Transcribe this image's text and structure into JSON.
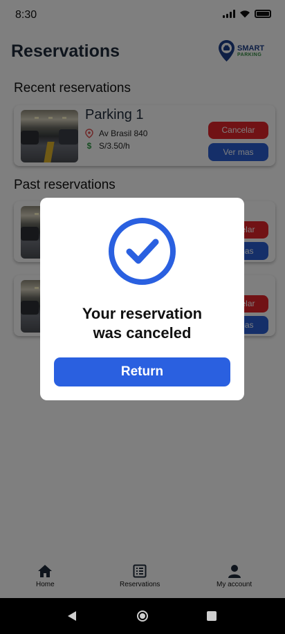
{
  "status_bar": {
    "time": "8:30"
  },
  "header": {
    "title": "Reservations",
    "logo_line1": "SMART",
    "logo_line2": "PARKING"
  },
  "recent": {
    "title": "Recent reservations",
    "card": {
      "name": "Parking 1",
      "address": "Av Brasil 840",
      "price": "S/3.50/h",
      "cancel_label": "Cancelar",
      "more_label": "Ver mas"
    }
  },
  "past": {
    "title": "Past reservations",
    "cards": [
      {
        "cancel_label": "Cancelar",
        "more_label": "Ver mas"
      },
      {
        "cancel_label": "Cancelar",
        "more_label": "Ver mas"
      }
    ]
  },
  "bottom_nav": {
    "items": [
      {
        "label": "Home",
        "icon": "home-icon"
      },
      {
        "label": "Reservations",
        "icon": "list-icon"
      },
      {
        "label": "My account",
        "icon": "person-icon"
      }
    ]
  },
  "modal": {
    "message_line1": "Your reservation",
    "message_line2": "was canceled",
    "button_label": "Return",
    "icon": "check-circle-icon"
  },
  "colors": {
    "primary": "#2a60e0",
    "danger": "#e3242b",
    "title": "#1f2a3a"
  }
}
